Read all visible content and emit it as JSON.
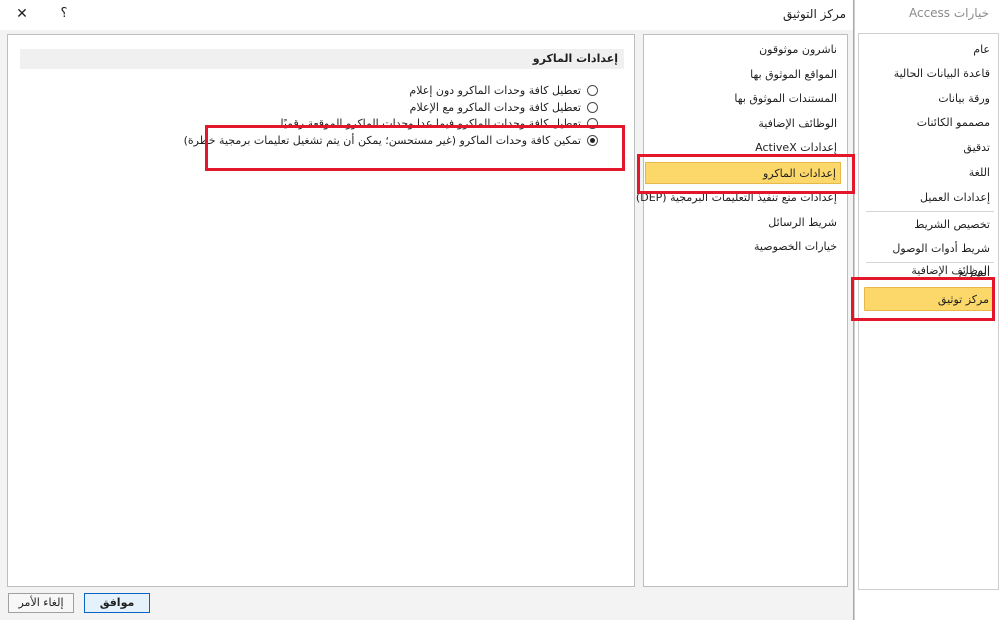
{
  "access_window": {
    "title": "خيارات Access",
    "nav_items": [
      {
        "label": "عام"
      },
      {
        "label": "قاعدة البيانات الحالية"
      },
      {
        "label": "ورقة بيانات"
      },
      {
        "label": "مصممو الكائنات"
      },
      {
        "label": "تدقيق"
      },
      {
        "label": "اللغة"
      },
      {
        "label": "إعدادات العميل"
      },
      {
        "label": "تخصيص الشريط"
      },
      {
        "label": "شريط أدوات الوصول السريع"
      },
      {
        "label": "الوظائف الإضافية"
      },
      {
        "label": "مركز توثيق"
      }
    ]
  },
  "dialog": {
    "title": "مركز التوثيق",
    "help_label": "؟",
    "close_label": "✕",
    "nav_items": [
      {
        "label": "ناشرون موثوقون"
      },
      {
        "label": "المواقع الموثوق بها"
      },
      {
        "label": "المستندات الموثوق بها"
      },
      {
        "label": "الوظائف الإضافية"
      },
      {
        "label": "إعدادات ActiveX"
      },
      {
        "label": "إعدادات الماكرو"
      },
      {
        "label": "إعدادات منع تنفيذ التعليمات البرمجية (DEP)"
      },
      {
        "label": "شريط الرسائل"
      },
      {
        "label": "خيارات الخصوصية"
      }
    ],
    "selected_nav": "إعدادات الماكرو",
    "section_title": "إعدادات الماكرو",
    "macro_options": [
      {
        "label": "تعطيل كافة وحدات الماكرو دون إعلام",
        "checked": false
      },
      {
        "label": "تعطيل كافة وحدات الماكرو مع الإعلام",
        "checked": false
      },
      {
        "label": "تعطيل كافة وحدات الماكرو فيما عدا وحدات الماكرو الموقعة رقميًا",
        "checked": false
      },
      {
        "label": "تمكين كافة وحدات الماكرو (غير مستحسن؛ يمكن أن يتم تشغيل تعليمات برمجية خطرة)",
        "checked": true
      }
    ],
    "ok_label": "موافق",
    "cancel_label": "إلغاء الأمر"
  },
  "colors": {
    "selection": "#fcd86b",
    "highlight_box": "#e3162a",
    "ok_border": "#0a64c8"
  }
}
